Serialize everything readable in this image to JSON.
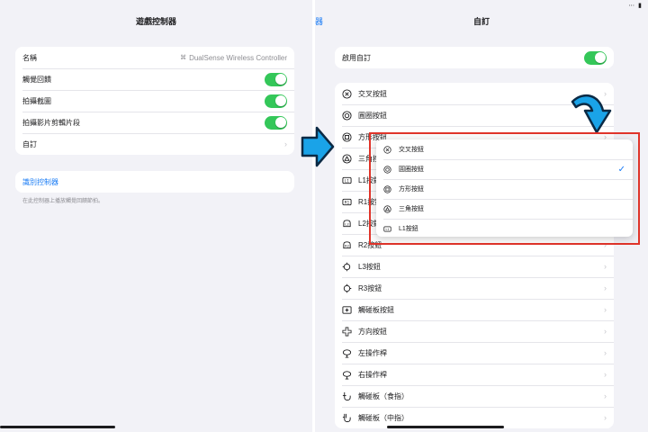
{
  "status_bar": {
    "text": "⋯ ▮"
  },
  "left": {
    "title": "遊戲控制器",
    "rows": [
      {
        "label": "名稱",
        "value": "DualSense Wireless Controller",
        "icon": "gamepad-icon"
      },
      {
        "label": "觸覺回饋",
        "toggle": true
      },
      {
        "label": "拍攝截圖",
        "toggle": true
      },
      {
        "label": "拍攝影片剪輯片段",
        "toggle": true
      },
      {
        "label": "自訂"
      }
    ],
    "identify_label": "識別控制器",
    "footnote": "在此控制器上播放觸覺回饋節拍。"
  },
  "right": {
    "back_label": "器",
    "title": "自訂",
    "enable_label": "啟用自訂",
    "buttons": [
      {
        "label": "交叉按鈕",
        "icon": "cross-button-icon"
      },
      {
        "label": "圓圈按鈕",
        "icon": "circle-button-icon"
      },
      {
        "label": "方形按鈕",
        "icon": "square-button-icon"
      },
      {
        "label": "三角按鈕",
        "icon": "triangle-button-icon"
      },
      {
        "label": "L1按鈕",
        "icon": "l1-button-icon"
      },
      {
        "label": "R1按鈕",
        "icon": "r1-button-icon"
      },
      {
        "label": "L2按鈕",
        "icon": "l2-button-icon"
      },
      {
        "label": "R2按鈕",
        "icon": "r2-button-icon"
      },
      {
        "label": "L3按鈕",
        "icon": "l3-button-icon"
      },
      {
        "label": "R3按鈕",
        "icon": "r3-button-icon"
      },
      {
        "label": "觸碰板按鈕",
        "icon": "touchpad-button-icon"
      },
      {
        "label": "方向按鈕",
        "icon": "dpad-icon"
      },
      {
        "label": "左操作桿",
        "icon": "left-stick-icon"
      },
      {
        "label": "右操作桿",
        "icon": "right-stick-icon"
      },
      {
        "label": "觸碰板（食指）",
        "icon": "touchpad-index-icon"
      },
      {
        "label": "觸碰板（中指）",
        "icon": "touchpad-middle-icon"
      }
    ]
  },
  "popup": {
    "options": [
      {
        "label": "交叉按鈕",
        "icon": "cross-button-icon",
        "selected": false
      },
      {
        "label": "圓圈按鈕",
        "icon": "circle-button-icon",
        "selected": true
      },
      {
        "label": "方形按鈕",
        "icon": "square-button-icon",
        "selected": false
      },
      {
        "label": "三角按鈕",
        "icon": "triangle-button-icon",
        "selected": false
      },
      {
        "label": "L1按鈕",
        "icon": "l1-button-icon",
        "selected": false
      }
    ],
    "check_glyph": "✓"
  },
  "colors": {
    "toggle_on": "#34c759",
    "link": "#1a7cf5",
    "highlight_box": "#e0342a",
    "arrow_fill": "#1aa3e8"
  }
}
